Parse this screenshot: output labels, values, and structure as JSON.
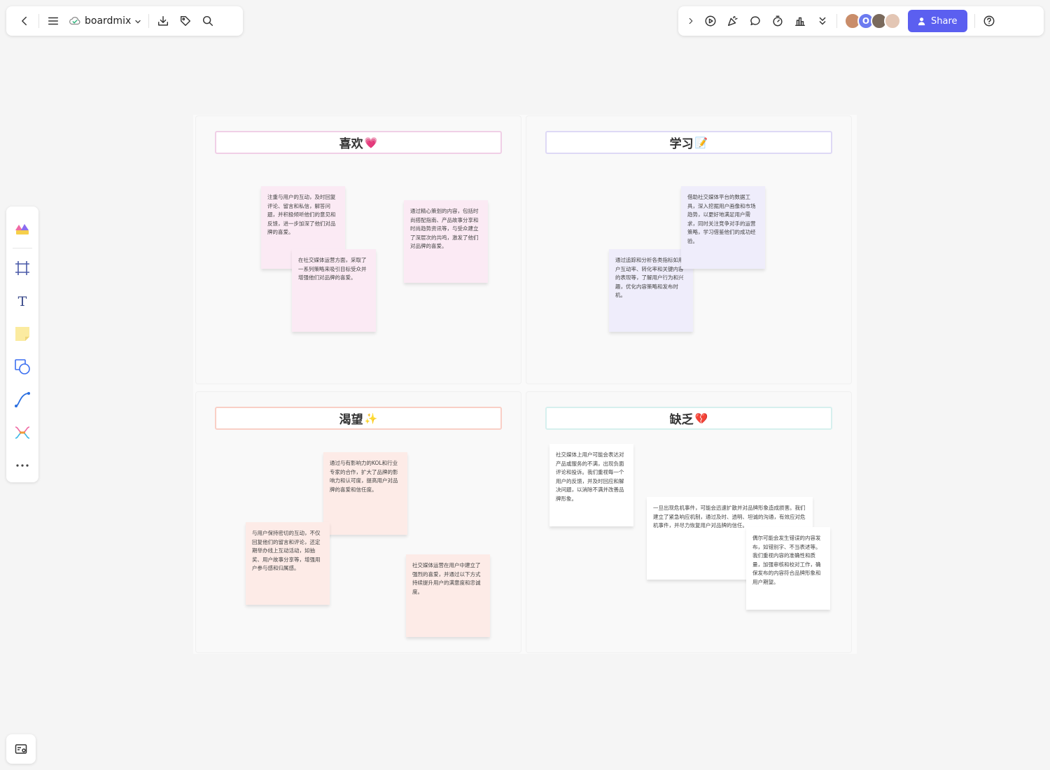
{
  "topbar": {
    "brand": "boardmix",
    "share_label": "Share",
    "avatar_initial": "O"
  },
  "colors": {
    "accent": "#5b5ff0",
    "pink_border": "#f0cfe6",
    "lavender_border": "#ded9f5",
    "peach_border": "#f9cfc6",
    "mint_border": "#d6f0ee"
  },
  "board": {
    "quadrants": [
      {
        "title": "喜欢",
        "emoji": "💗",
        "notes": [
          "注重与用户的互动，及时回复评论、留言和私信，解答问题，并积极倾听他们的意见和反馈，进一步加深了他们对品牌的喜爱。",
          "在社交媒体运营方面，采取了一系列策略来吸引目标受众并增强他们对品牌的喜爱。",
          "通过精心策划的内容，包括时尚搭配指南、产品故事分享和时尚趋势资讯等，与受众建立了深层次的共鸣，激发了他们对品牌的喜爱。"
        ]
      },
      {
        "title": "学习",
        "emoji": "📝",
        "notes": [
          "借助社交媒体平台的数据工具，深入挖掘用户画像和市场趋势，以更好地满足用户需求，同时关注竞争对手的运营策略，学习借鉴他们的成功经验。",
          "通过追踪和分析各类指标如用户互动率、转化率和关键内容的表现等，了解用户行为和兴趣，优化内容策略和发布时机。"
        ]
      },
      {
        "title": "渴望",
        "emoji": "✨",
        "notes": [
          "通过与有影响力的KOL和行业专家的合作，扩大了品牌的影响力和认可度，提高用户对品牌的喜爱和信任度。",
          "与用户保持密切的互动，不仅回复他们的留言和评论，还定期举办线上互动活动，如抽奖、用户故事分享等，增强用户参与感和归属感。",
          "社交媒体运营在用户中建立了强烈的喜爱，并通过以下方式持续提升用户的满意度和忠诚度。"
        ]
      },
      {
        "title": "缺乏",
        "emoji": "💔",
        "notes": [
          "社交媒体上用户可能会表达对产品或服务的不满，出现负面评论和投诉。我们重视每一个用户的反馈，并及时回应和解决问题，以消除不满并改善品牌形象。",
          "一旦出现危机事件，可能会迅速扩散并对品牌形象造成损害。我们建立了紧急响应机制，通过及时、透明、坦诚的沟通，有效应对危机事件，并尽力恢复用户对品牌的信任。",
          "偶尔可能会发生错误的内容发布，如错别字、不当表述等。我们重视内容的准确性和质量，加强审核和校对工作，确保发布的内容符合品牌形象和用户期望。"
        ]
      }
    ]
  }
}
